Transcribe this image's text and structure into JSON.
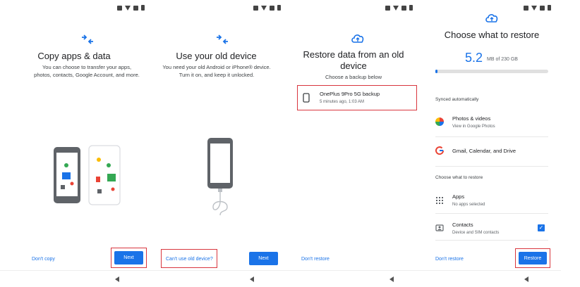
{
  "panel1": {
    "title": "Copy apps & data",
    "description": "You can choose to transfer your apps, photos, contacts, Google Account, and more.",
    "secondary_link": "Don't copy",
    "primary_button": "Next"
  },
  "panel2": {
    "title": "Use your old device",
    "description": "You need your old Android or iPhone® device. Turn it on, and keep it unlocked.",
    "secondary_link": "Can't use old device?",
    "primary_button": "Next"
  },
  "panel3": {
    "title": "Restore data from an old device",
    "subtitle": "Choose a backup below",
    "backup": {
      "name": "OnePlus 9Pro 5G backup",
      "time": "5 minutes ago, 1:03 AM"
    },
    "secondary_link": "Don't restore"
  },
  "panel4": {
    "title": "Choose what to restore",
    "storage_value": "5.2",
    "storage_unit": "MB of 230 GB",
    "storage_fraction": 0.02,
    "synced_label": "Synced automatically",
    "synced_items": [
      {
        "title": "Photos & videos",
        "subtitle": "View in Google Photos",
        "icon": "google-photos-icon"
      },
      {
        "title": "Gmail, Calendar, and Drive",
        "subtitle": "",
        "icon": "google-g-icon"
      }
    ],
    "choose_label": "Choose what to restore",
    "restore_items": [
      {
        "title": "Apps",
        "subtitle": "No apps selected",
        "icon": "apps-grid-icon",
        "checked": false
      },
      {
        "title": "Contacts",
        "subtitle": "Device and SIM contacts",
        "icon": "contacts-icon",
        "checked": true
      }
    ],
    "secondary_link": "Don't restore",
    "primary_button": "Restore"
  },
  "colors": {
    "accent": "#1a73e8",
    "highlight": "#d9363e"
  }
}
